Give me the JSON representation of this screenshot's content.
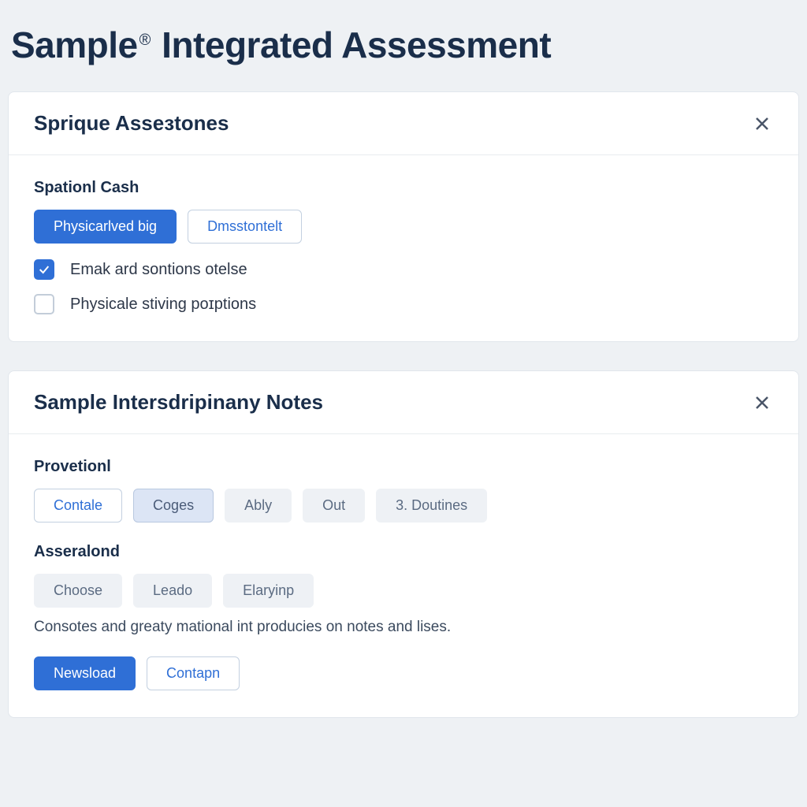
{
  "page": {
    "title_prefix": "Sample",
    "title_suffix": "Integrated Assessment"
  },
  "card1": {
    "title": "Sprique Asseɜtones",
    "section_label": "Spationl Cash",
    "buttons": {
      "primary": "Physicarlved big",
      "secondary": "Dmsstontelt"
    },
    "checkboxes": [
      {
        "label": "Emak ard sontions otelse",
        "checked": true
      },
      {
        "label": "Physicale stiving poɪptions",
        "checked": false
      }
    ]
  },
  "card2": {
    "title": "Sample Intersdripinany Notes",
    "section1": {
      "label": "Provetionl",
      "tabs": [
        "Contale",
        "Coges",
        "Ably",
        "Out",
        "3. Doutines"
      ]
    },
    "section2": {
      "label": "Asseralond",
      "tabs": [
        "Choose",
        "Leado",
        "Elaryinp"
      ]
    },
    "description": "Consotes and greaty mational int producies on notes and lises.",
    "actions": {
      "primary": "Newsload",
      "secondary": "Contapn"
    }
  }
}
